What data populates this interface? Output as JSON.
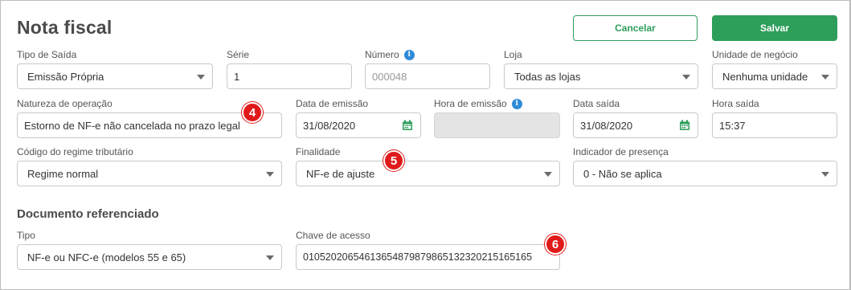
{
  "header": {
    "title": "Nota fiscal",
    "cancel_label": "Cancelar",
    "save_label": "Salvar"
  },
  "row1": {
    "tipo_saida": {
      "label": "Tipo de Saída",
      "value": "Emissão Própria"
    },
    "serie": {
      "label": "Série",
      "value": "1"
    },
    "numero": {
      "label": "Número",
      "placeholder": "000048"
    },
    "loja": {
      "label": "Loja",
      "value": "Todas as lojas"
    },
    "unidade": {
      "label": "Unidade de negócio",
      "value": "Nenhuma unidade"
    }
  },
  "row2": {
    "natureza": {
      "label": "Natureza de operação",
      "value": "Estorno de NF-e não cancelada no prazo legal"
    },
    "data_emissao": {
      "label": "Data de emissão",
      "value": "31/08/2020"
    },
    "hora_emissao": {
      "label": "Hora de emissão",
      "value": ""
    },
    "data_saida": {
      "label": "Data saída",
      "value": "31/08/2020"
    },
    "hora_saida": {
      "label": "Hora saída",
      "value": "15:37"
    }
  },
  "row3": {
    "regime": {
      "label": "Código do regime tributário",
      "value": "Regime normal"
    },
    "finalidade": {
      "label": "Finalidade",
      "value": "NF-e de ajuste"
    },
    "presenca": {
      "label": "Indicador de presença",
      "value": "0 - Não se aplica"
    }
  },
  "referenciado": {
    "title": "Documento referenciado",
    "tipo": {
      "label": "Tipo",
      "value": "NF-e ou NFC-e (modelos 55 e 65)"
    },
    "chave": {
      "label": "Chave de acesso",
      "value": "01052020654613654879879865132320215165165"
    }
  },
  "annotations": {
    "badge4": "4",
    "badge5": "5",
    "badge6": "6"
  },
  "colors": {
    "accent": "#2e9e5b",
    "info": "#2d8bd8",
    "badge": "#e01a1a"
  }
}
